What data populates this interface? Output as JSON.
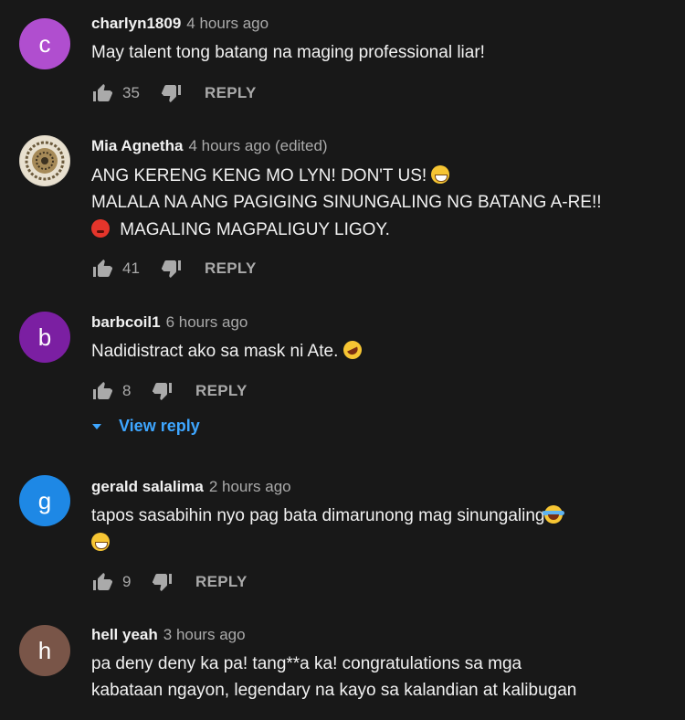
{
  "comments": [
    {
      "author": "charlyn1809",
      "time": "4 hours ago",
      "avatar_letter": "c",
      "avatar_color": "#b04ecf",
      "lines": [
        "May talent tong batang na maging professional liar!"
      ],
      "likes": "35",
      "reply_label": "REPLY"
    },
    {
      "author": "Mia Agnetha",
      "time": "4 hours ago (edited)",
      "avatar_letter": "",
      "avatar_color": "#8a7a5c",
      "lines": [
        "ANG KERENG KENG MO LYN! DON'T US!",
        "MALALA NA ANG PAGIGING SINUNGALING NG BATANG A-RE!!",
        "MAGALING MAGPALIGUY LIGOY."
      ],
      "likes": "41",
      "reply_label": "REPLY"
    },
    {
      "author": "barbcoil1",
      "time": "6 hours ago",
      "avatar_letter": "b",
      "avatar_color": "#7b1fa2",
      "lines": [
        "Nadidistract ako sa mask ni Ate."
      ],
      "likes": "8",
      "reply_label": "REPLY",
      "view_reply": "View reply"
    },
    {
      "author": "gerald salalima",
      "time": "2 hours ago",
      "avatar_letter": "g",
      "avatar_color": "#1e88e5",
      "lines": [
        "tapos sasabihin nyo pag bata dimarunong mag sinungaling"
      ],
      "likes": "9",
      "reply_label": "REPLY"
    },
    {
      "author": "hell yeah",
      "time": "3 hours ago",
      "avatar_letter": "h",
      "avatar_color": "#795548",
      "lines": [
        "pa deny deny ka pa! tang**a ka! congratulations sa mga",
        "kabataan ngayon, legendary na kayo sa kalandian at kalibugan"
      ]
    }
  ],
  "icons": {
    "like": "thumbs-up-icon",
    "dislike": "thumbs-down-icon",
    "expand": "caret-down-icon"
  }
}
